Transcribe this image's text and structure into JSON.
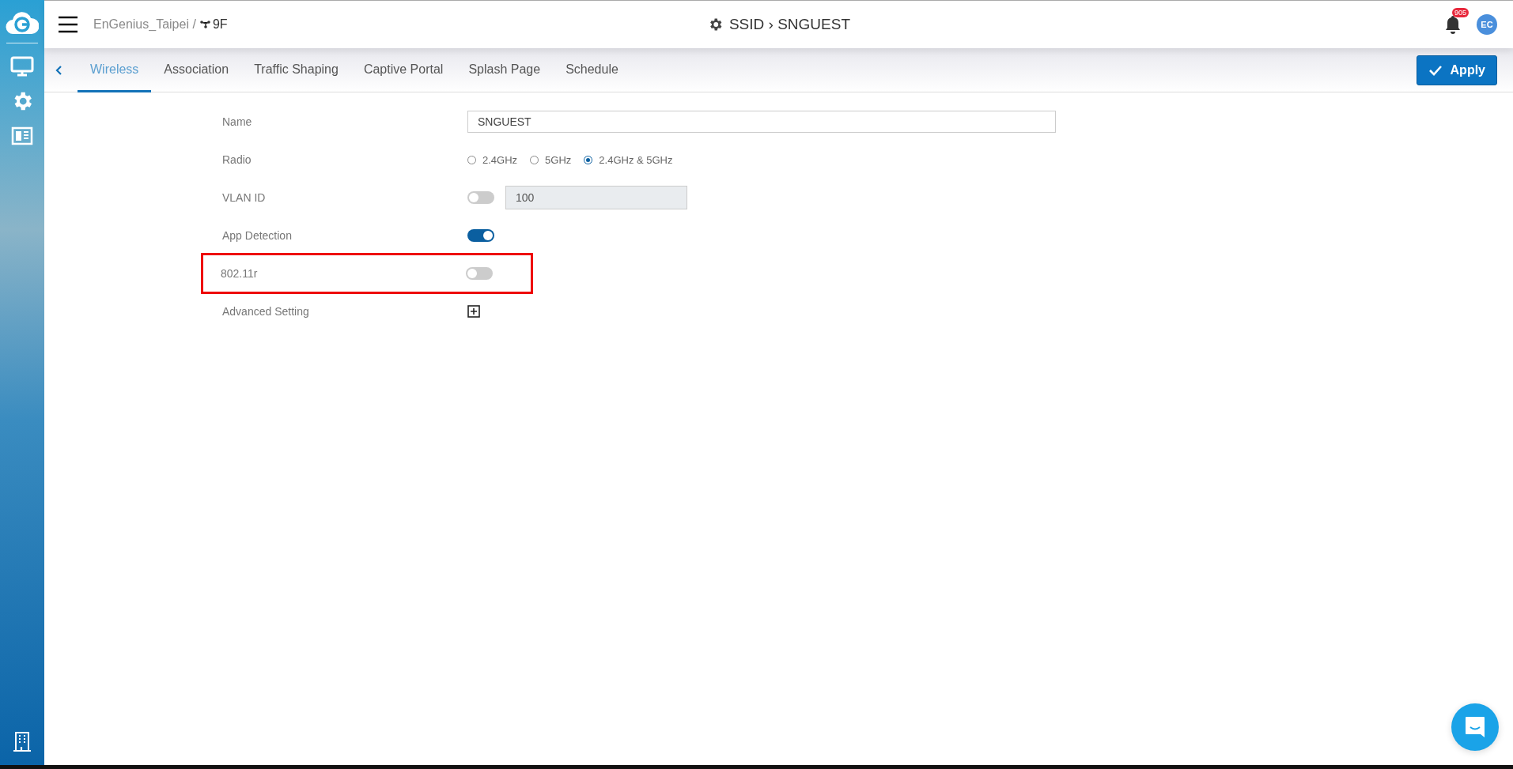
{
  "header": {
    "breadcrumb": {
      "org": "EnGenius_Taipei",
      "separator": "/",
      "floor": "9F"
    },
    "title": {
      "section": "SSID",
      "separator": "›",
      "name": "SNGUEST"
    },
    "notification_count": "905",
    "avatar": "EC"
  },
  "tabs": [
    {
      "label": "Wireless",
      "selected": true
    },
    {
      "label": "Association",
      "selected": false
    },
    {
      "label": "Traffic Shaping",
      "selected": false
    },
    {
      "label": "Captive Portal",
      "selected": false
    },
    {
      "label": "Splash Page",
      "selected": false
    },
    {
      "label": "Schedule",
      "selected": false
    }
  ],
  "apply_button": "Apply",
  "form": [
    {
      "kind": "text",
      "label": "Name",
      "value": "SNGUEST",
      "highlighted": false
    },
    {
      "kind": "radio",
      "label": "Radio",
      "highlighted": false,
      "options": [
        {
          "label": "2.4GHz",
          "selected": false
        },
        {
          "label": "5GHz",
          "selected": false
        },
        {
          "label": "2.4GHz & 5GHz",
          "selected": true
        }
      ]
    },
    {
      "kind": "toggle_input",
      "label": "VLAN ID",
      "on": false,
      "value": "100",
      "highlighted": false
    },
    {
      "kind": "toggle",
      "label": "App Detection",
      "on": true,
      "highlighted": false
    },
    {
      "kind": "toggle",
      "label": "802.11r",
      "on": false,
      "highlighted": true
    },
    {
      "kind": "expand",
      "label": "Advanced Setting",
      "expanded": false,
      "highlighted": false
    }
  ]
}
